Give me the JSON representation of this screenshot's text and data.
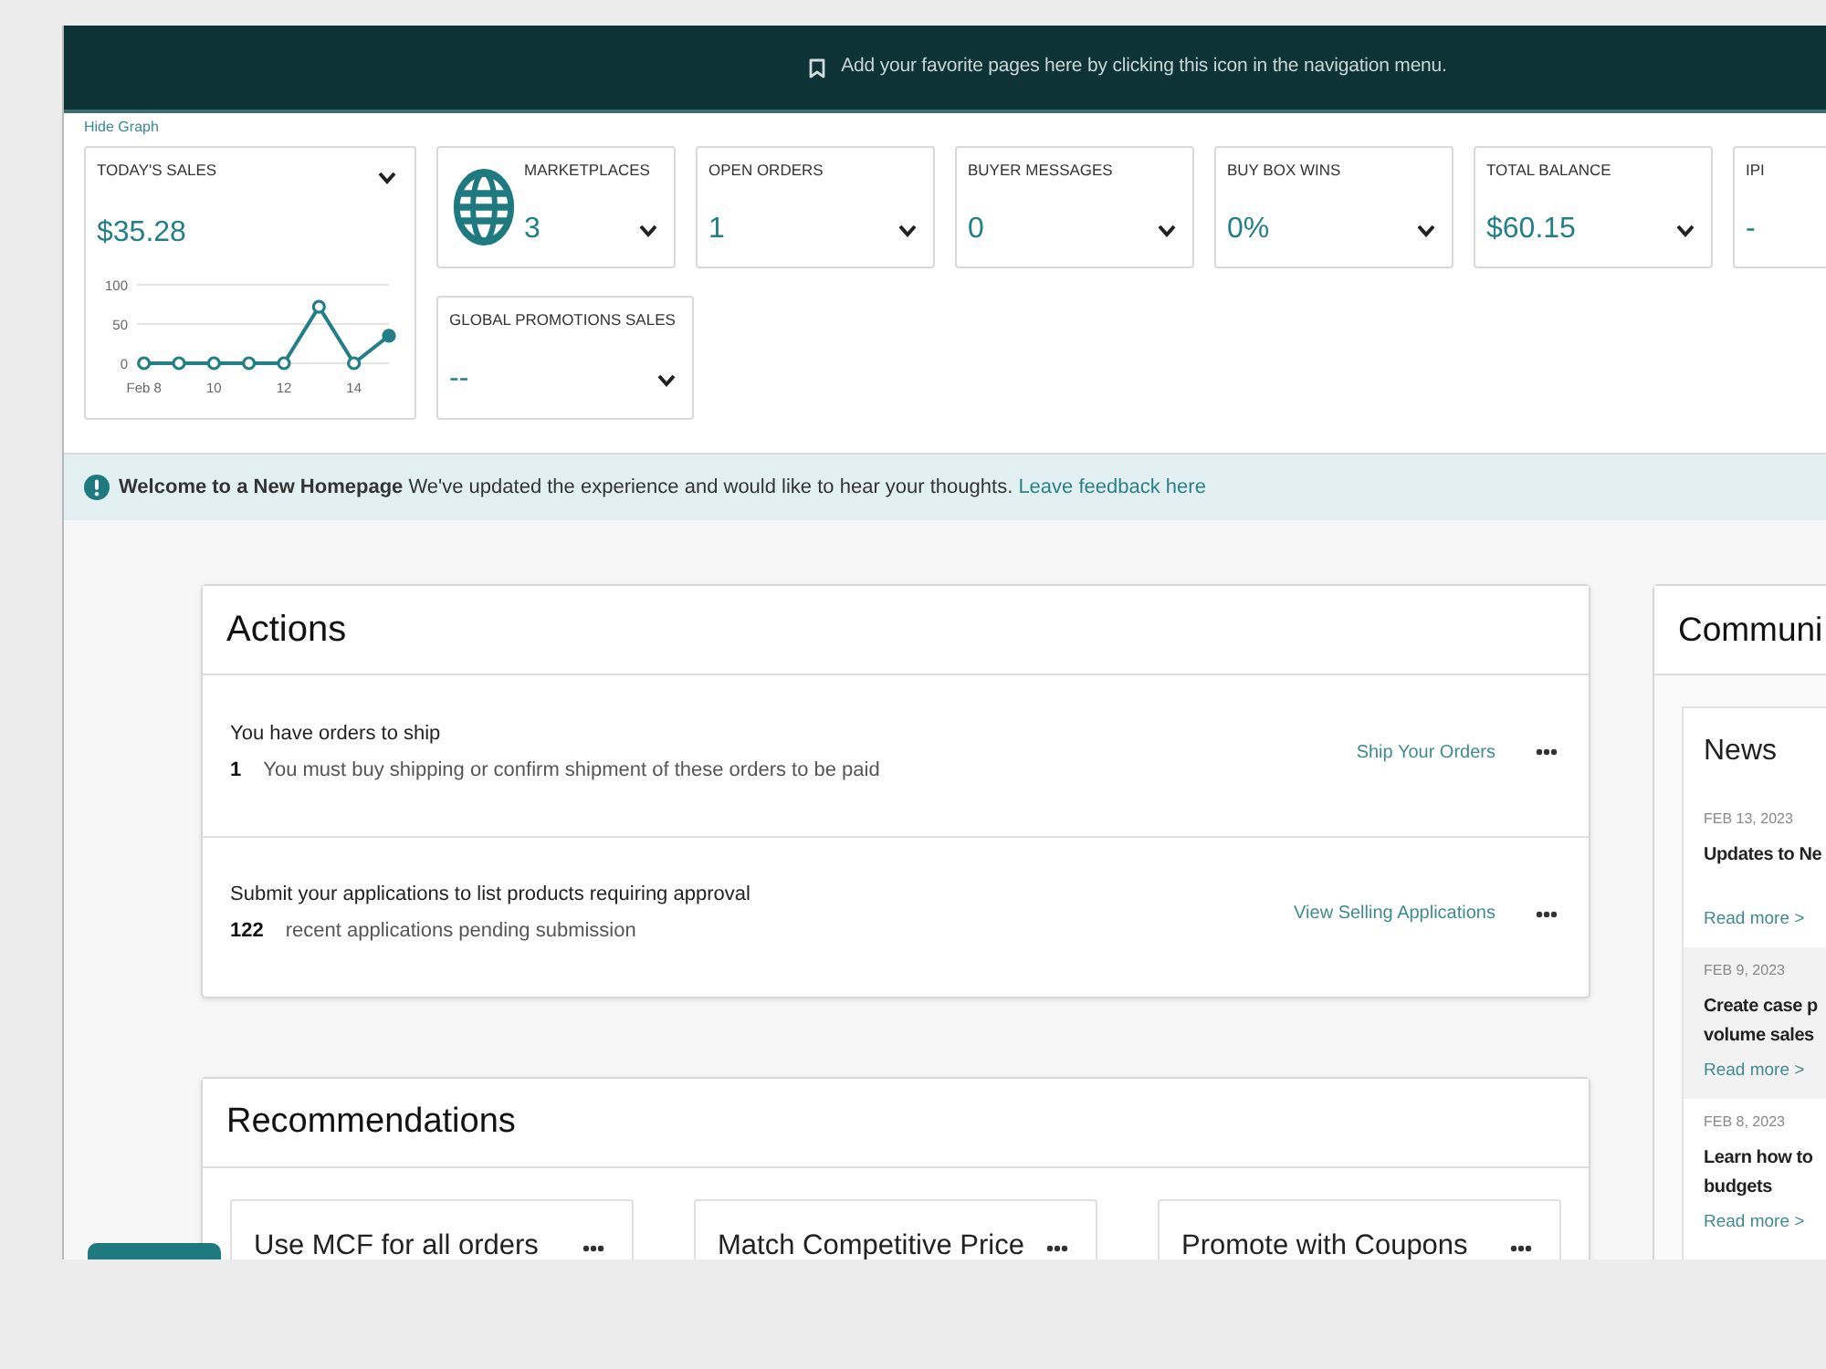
{
  "top_bar": {
    "message": "Add your favorite pages here by clicking this icon in the navigation menu."
  },
  "graph_toggle": "Hide Graph",
  "sales_card": {
    "label": "TODAY'S SALES",
    "value": "$35.28",
    "dropdown": true,
    "chart_data": {
      "type": "line",
      "marker": "circle",
      "x": [
        8,
        9,
        10,
        11,
        12,
        13,
        14,
        15
      ],
      "xlim": [
        7.8,
        15
      ],
      "xticks": [
        {
          "value": 8,
          "label": "Feb 8"
        },
        10,
        12,
        14
      ],
      "ylim": [
        0,
        100
      ],
      "yticks": [
        0,
        50,
        100
      ],
      "values": [
        0,
        0,
        0,
        0,
        0,
        72,
        0,
        35
      ]
    }
  },
  "metric_rows": [
    {
      "cards": [
        {
          "kind": "icon",
          "label": "MARKETPLACES",
          "value": "3",
          "dropdown": true
        },
        {
          "kind": "plain",
          "label": "OPEN ORDERS",
          "value": "1",
          "dropdown": true
        },
        {
          "kind": "plain",
          "label": "BUYER MESSAGES",
          "value": "0",
          "dropdown": true
        },
        {
          "kind": "plain",
          "label": "BUY BOX WINS",
          "value": "0%",
          "dropdown": true
        },
        {
          "kind": "plain",
          "label": "TOTAL BALANCE",
          "value": "$60.15",
          "dropdown": true
        },
        {
          "kind": "plain",
          "label": "IPI",
          "value": "-",
          "dropdown": false
        }
      ]
    },
    {
      "cards": [
        {
          "kind": "plain",
          "label": "GLOBAL PROMOTIONS SALES",
          "value": "--",
          "dropdown": true
        }
      ]
    }
  ],
  "welcome_banner": {
    "message": "**Welcome to a New Homepage** We've updated the experience and would like to hear your thoughts.",
    "link": "Leave feedback here"
  },
  "actions": {
    "title": "Actions",
    "items": [
      {
        "title": "You have orders to ship",
        "count": "1",
        "detail": "You must buy shipping or confirm shipment of these orders to be paid",
        "link": "Ship Your Orders"
      },
      {
        "title": "Submit your applications to list products requiring approval",
        "count": "122",
        "detail": "recent applications pending submission",
        "link": "View Selling Applications"
      }
    ]
  },
  "recommendations": {
    "title": "Recommendations",
    "cards": [
      {
        "title": "Use MCF for all orders"
      },
      {
        "title": "Match Competitive Price"
      },
      {
        "title": "Promote with Coupons"
      }
    ]
  },
  "community": {
    "title": "Communi",
    "news": {
      "title": "News",
      "items": [
        {
          "date": "FEB 13, 2023",
          "title_lines": [
            "Updates to Ne"
          ],
          "link": "Read more >",
          "highlighted": false
        },
        {
          "date": "FEB 9, 2023",
          "title_lines": [
            "Create case p",
            "volume sales"
          ],
          "link": "Read more >",
          "highlighted": true
        },
        {
          "date": "FEB 8, 2023",
          "title_lines": [
            "Learn how to",
            "budgets"
          ],
          "link": "Read more >",
          "highlighted": false
        }
      ]
    }
  }
}
